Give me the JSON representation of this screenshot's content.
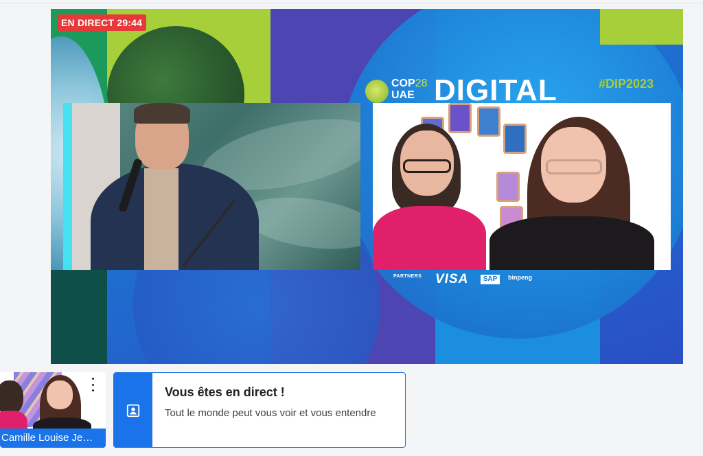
{
  "stream": {
    "live_badge": "EN DIRECT 29:44"
  },
  "event_banner": {
    "cop_label": "COP",
    "cop_number": "28",
    "cop_region": "UAE",
    "title": "DIGITAL",
    "hashtag": "#DIP2023",
    "partners_label": "PARTNERS",
    "partners": [
      "VISA",
      "SAP",
      "binpeng"
    ]
  },
  "self_view": {
    "name": "Camille Louise Je…",
    "menu_icon": "more-vertical-icon"
  },
  "notice": {
    "icon": "person-frame-icon",
    "title": "Vous êtes en direct !",
    "body": "Tout le monde peut vous voir et vous entendre"
  },
  "colors": {
    "live_red": "#e63a3a",
    "accent_blue": "#1a73e8",
    "lime": "#a7cf3a"
  }
}
